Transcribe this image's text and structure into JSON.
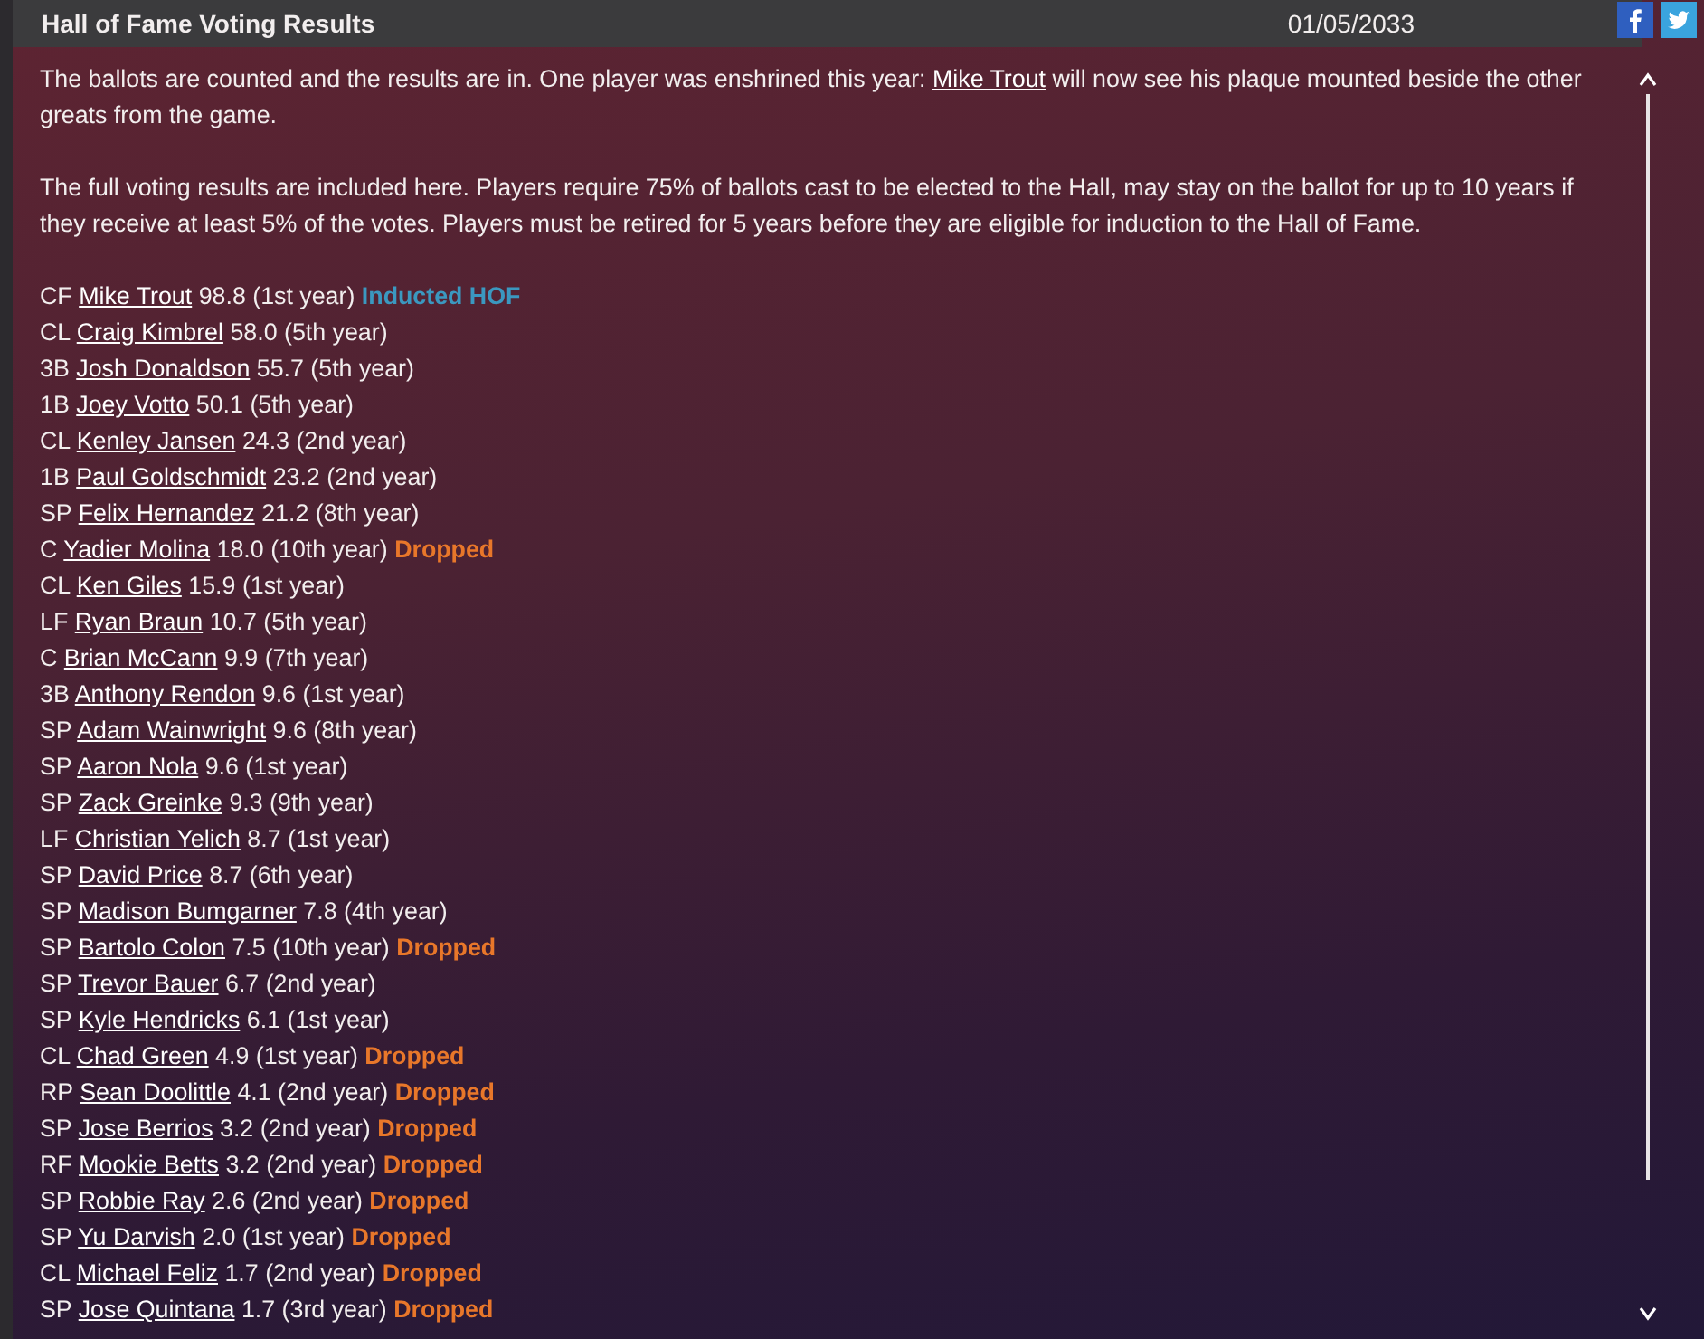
{
  "header": {
    "title": "Hall of Fame Voting Results",
    "date": "01/05/2033"
  },
  "intro": {
    "before": "The ballots are counted and the results are in. One player was enshrined this year: ",
    "link": "Mike Trout",
    "after": " will now see his plaque mounted beside the other greats from the game."
  },
  "rules": "The full voting results are included here. Players require 75% of ballots cast to be elected to the Hall, may stay on the ballot for up to 10 years if they receive at least 5% of the votes. Players must be retired for 5 years before they are eligible for induction to the Hall of Fame.",
  "results": [
    {
      "position": "CF",
      "name": "Mike Trout",
      "stats": "98.8 (1st year)",
      "status": {
        "kind": "inducted",
        "text": "Inducted HOF"
      }
    },
    {
      "position": "CL",
      "name": "Craig Kimbrel",
      "stats": "58.0 (5th year)"
    },
    {
      "position": "3B",
      "name": "Josh Donaldson",
      "stats": "55.7 (5th year)"
    },
    {
      "position": "1B",
      "name": "Joey Votto",
      "stats": "50.1 (5th year)"
    },
    {
      "position": "CL",
      "name": "Kenley Jansen",
      "stats": "24.3 (2nd year)"
    },
    {
      "position": "1B",
      "name": "Paul Goldschmidt",
      "stats": "23.2 (2nd year)"
    },
    {
      "position": "SP",
      "name": "Felix Hernandez",
      "stats": "21.2 (8th year)"
    },
    {
      "position": "C",
      "name": "Yadier Molina",
      "stats": "18.0 (10th year)",
      "status": {
        "kind": "dropped",
        "text": "Dropped"
      }
    },
    {
      "position": "CL",
      "name": "Ken Giles",
      "stats": "15.9 (1st year)"
    },
    {
      "position": "LF",
      "name": "Ryan Braun",
      "stats": "10.7 (5th year)"
    },
    {
      "position": "C",
      "name": "Brian McCann",
      "stats": "9.9 (7th year)"
    },
    {
      "position": "3B",
      "name": "Anthony Rendon",
      "stats": "9.6 (1st year)"
    },
    {
      "position": "SP",
      "name": "Adam Wainwright",
      "stats": "9.6 (8th year)"
    },
    {
      "position": "SP",
      "name": "Aaron Nola",
      "stats": "9.6 (1st year)"
    },
    {
      "position": "SP",
      "name": "Zack Greinke",
      "stats": "9.3 (9th year)"
    },
    {
      "position": "LF",
      "name": "Christian Yelich",
      "stats": "8.7 (1st year)"
    },
    {
      "position": "SP",
      "name": "David Price",
      "stats": "8.7 (6th year)"
    },
    {
      "position": "SP",
      "name": "Madison Bumgarner",
      "stats": "7.8 (4th year)"
    },
    {
      "position": "SP",
      "name": "Bartolo Colon",
      "stats": "7.5 (10th year)",
      "status": {
        "kind": "dropped",
        "text": "Dropped"
      }
    },
    {
      "position": "SP",
      "name": "Trevor Bauer",
      "stats": "6.7 (2nd year)"
    },
    {
      "position": "SP",
      "name": "Kyle Hendricks",
      "stats": "6.1 (1st year)"
    },
    {
      "position": "CL",
      "name": "Chad Green",
      "stats": "4.9 (1st year)",
      "status": {
        "kind": "dropped",
        "text": "Dropped"
      }
    },
    {
      "position": "RP",
      "name": "Sean Doolittle",
      "stats": "4.1 (2nd year)",
      "status": {
        "kind": "dropped",
        "text": "Dropped"
      }
    },
    {
      "position": "SP",
      "name": "Jose Berrios",
      "stats": "3.2 (2nd year)",
      "status": {
        "kind": "dropped",
        "text": "Dropped"
      }
    },
    {
      "position": "RF",
      "name": "Mookie Betts",
      "stats": "3.2 (2nd year)",
      "status": {
        "kind": "dropped",
        "text": "Dropped"
      }
    },
    {
      "position": "SP",
      "name": "Robbie Ray",
      "stats": "2.6 (2nd year)",
      "status": {
        "kind": "dropped",
        "text": "Dropped"
      }
    },
    {
      "position": "SP",
      "name": "Yu Darvish",
      "stats": "2.0 (1st year)",
      "status": {
        "kind": "dropped",
        "text": "Dropped"
      }
    },
    {
      "position": "CL",
      "name": "Michael Feliz",
      "stats": "1.7 (2nd year)",
      "status": {
        "kind": "dropped",
        "text": "Dropped"
      }
    },
    {
      "position": "SP",
      "name": "Jose Quintana",
      "stats": "1.7 (3rd year)",
      "status": {
        "kind": "dropped",
        "text": "Dropped"
      }
    }
  ]
}
